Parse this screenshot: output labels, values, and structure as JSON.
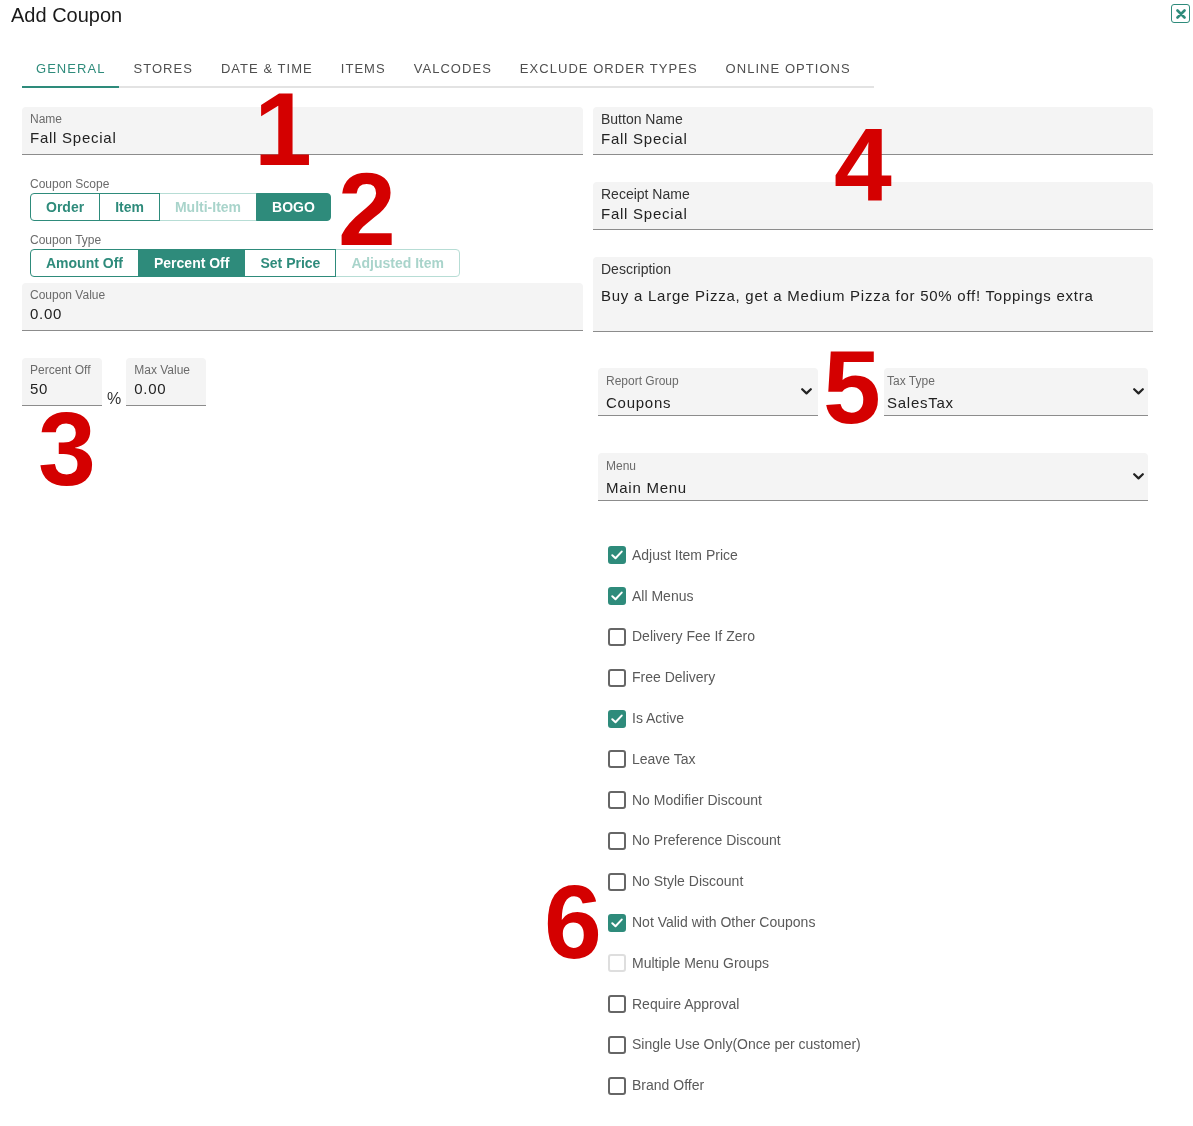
{
  "dialog": {
    "title": "Add Coupon"
  },
  "tabs": [
    {
      "label": "GENERAL",
      "selected": true
    },
    {
      "label": "STORES",
      "selected": false
    },
    {
      "label": "DATE & TIME",
      "selected": false
    },
    {
      "label": "ITEMS",
      "selected": false
    },
    {
      "label": "VALCODES",
      "selected": false
    },
    {
      "label": "EXCLUDE ORDER TYPES",
      "selected": false
    },
    {
      "label": "ONLINE OPTIONS",
      "selected": false
    }
  ],
  "name": {
    "label": "Name",
    "value": "Fall Special"
  },
  "coupon_scope": {
    "label": "Coupon Scope",
    "options": [
      {
        "label": "Order",
        "selected": false,
        "disabled": false
      },
      {
        "label": "Item",
        "selected": false,
        "disabled": false
      },
      {
        "label": "Multi-Item",
        "selected": false,
        "disabled": true
      },
      {
        "label": "BOGO",
        "selected": true,
        "disabled": false
      }
    ]
  },
  "coupon_type": {
    "label": "Coupon Type",
    "options": [
      {
        "label": "Amount Off",
        "selected": false,
        "disabled": false
      },
      {
        "label": "Percent Off",
        "selected": true,
        "disabled": false
      },
      {
        "label": "Set Price",
        "selected": false,
        "disabled": false
      },
      {
        "label": "Adjusted Item",
        "selected": false,
        "disabled": true
      }
    ]
  },
  "coupon_value": {
    "label": "Coupon Value",
    "value": "0.00"
  },
  "percent_off": {
    "label": "Percent Off",
    "value": "50",
    "unit": "%"
  },
  "max_value": {
    "label": "Max Value",
    "value": "0.00"
  },
  "button_name": {
    "label": "Button Name",
    "value": "Fall Special"
  },
  "receipt_name": {
    "label": "Receipt Name",
    "value": "Fall Special"
  },
  "description": {
    "label": "Description",
    "value": "Buy a Large Pizza, get a Medium Pizza for 50% off! Toppings extra"
  },
  "report_group": {
    "label": "Report Group",
    "value": "Coupons"
  },
  "tax_type": {
    "label": "Tax Type",
    "value": "SalesTax"
  },
  "menu": {
    "label": "Menu",
    "value": "Main Menu"
  },
  "options": [
    {
      "label": "Adjust Item Price",
      "checked": true,
      "disabled": false
    },
    {
      "label": "All Menus",
      "checked": true,
      "disabled": false
    },
    {
      "label": "Delivery Fee If Zero",
      "checked": false,
      "disabled": false
    },
    {
      "label": "Free Delivery",
      "checked": false,
      "disabled": false
    },
    {
      "label": "Is Active",
      "checked": true,
      "disabled": false
    },
    {
      "label": "Leave Tax",
      "checked": false,
      "disabled": false
    },
    {
      "label": "No Modifier Discount",
      "checked": false,
      "disabled": false
    },
    {
      "label": "No Preference Discount",
      "checked": false,
      "disabled": false
    },
    {
      "label": "No Style Discount",
      "checked": false,
      "disabled": false
    },
    {
      "label": "Not Valid with Other Coupons",
      "checked": true,
      "disabled": false
    },
    {
      "label": "Multiple Menu Groups",
      "checked": false,
      "disabled": true
    },
    {
      "label": "Require Approval",
      "checked": false,
      "disabled": false
    },
    {
      "label": "Single Use Only(Once per customer)",
      "checked": false,
      "disabled": false
    },
    {
      "label": "Brand Offer",
      "checked": false,
      "disabled": false
    }
  ],
  "callouts": [
    "1",
    "2",
    "3",
    "4",
    "5",
    "6"
  ]
}
